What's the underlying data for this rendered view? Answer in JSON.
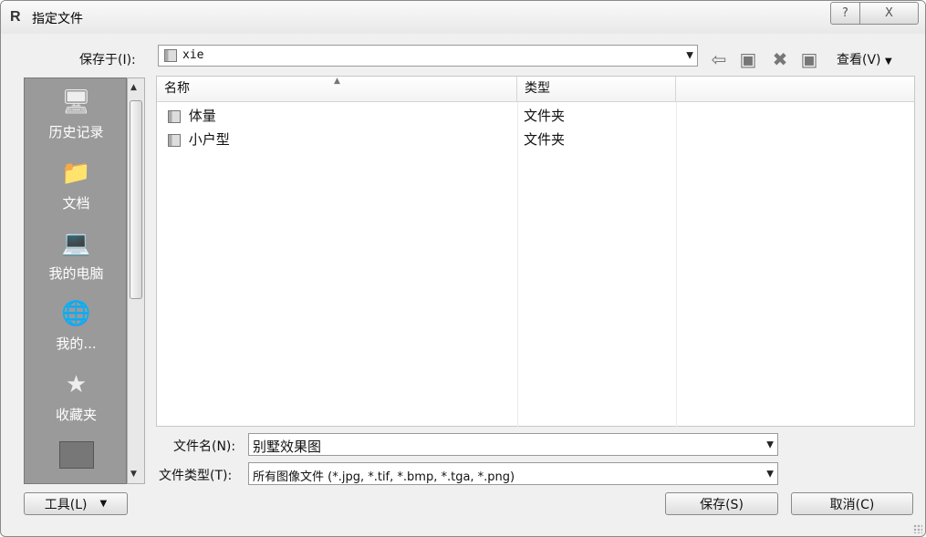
{
  "window": {
    "title": "指定文件",
    "help_label": "?",
    "close_label": "X"
  },
  "save_in": {
    "label": "保存于(I):",
    "value": "xie"
  },
  "toolbar": {
    "back_icon": "back-arrow-icon",
    "up_folder_icon": "up-folder-icon",
    "delete_icon": "delete-icon",
    "new_folder_icon": "new-folder-icon",
    "views_label": "查看(V)"
  },
  "places": [
    {
      "label": "历史记录",
      "icon": "history-icon"
    },
    {
      "label": "文档",
      "icon": "documents-icon"
    },
    {
      "label": "我的电脑",
      "icon": "my-computer-icon"
    },
    {
      "label": "我的...",
      "icon": "network-icon"
    },
    {
      "label": "收藏夹",
      "icon": "favorites-icon"
    }
  ],
  "columns": {
    "name": "名称",
    "type": "类型"
  },
  "files": [
    {
      "name": "体量",
      "type": "文件夹"
    },
    {
      "name": "小户型",
      "type": "文件夹"
    }
  ],
  "file_name": {
    "label": "文件名(N):",
    "value": "别墅效果图"
  },
  "file_type": {
    "label": "文件类型(T):",
    "value": "所有图像文件 (*.jpg, *.tif, *.bmp, *.tga, *.png)"
  },
  "buttons": {
    "tools": "工具(L)",
    "save": "保存(S)",
    "cancel": "取消(C)"
  }
}
